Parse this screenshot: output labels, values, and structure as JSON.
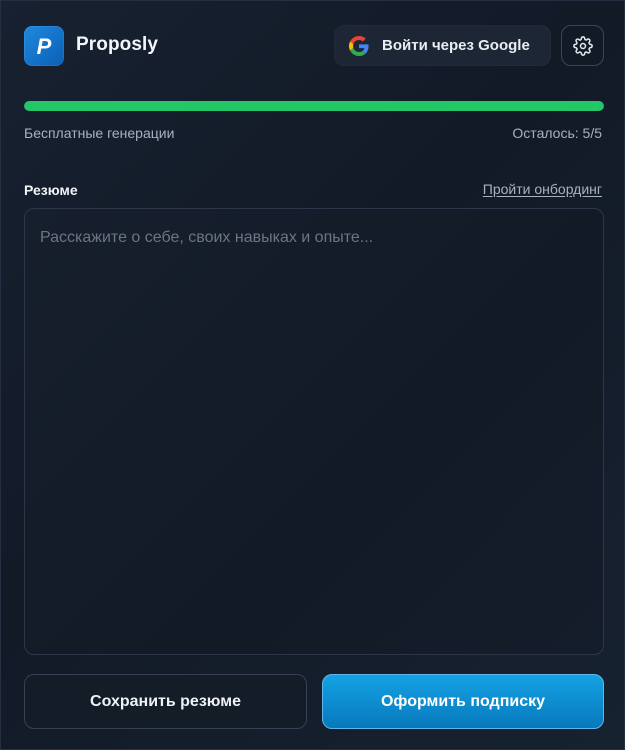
{
  "app": {
    "title": "Proposly",
    "logo_letter": "P",
    "logo_color": "#1276cf"
  },
  "header": {
    "google_button_label": "Войти через Google",
    "google_icon": "google-icon",
    "settings_icon": "gear-icon"
  },
  "usage": {
    "label": "Бесплатные генерации",
    "remaining_text": "Осталось: 5/5",
    "remaining": 5,
    "total": 5,
    "progress_fraction": 1.0,
    "bar_color": "#22c768"
  },
  "resume": {
    "label": "Резюме",
    "onboarding_link": "Пройти онбординг",
    "placeholder": "Расскажите о себе, своих навыках и опыте...",
    "value": ""
  },
  "actions": {
    "save_label": "Сохранить резюме",
    "subscribe_label": "Оформить подписку",
    "accent_color": "#0e8fd6"
  }
}
